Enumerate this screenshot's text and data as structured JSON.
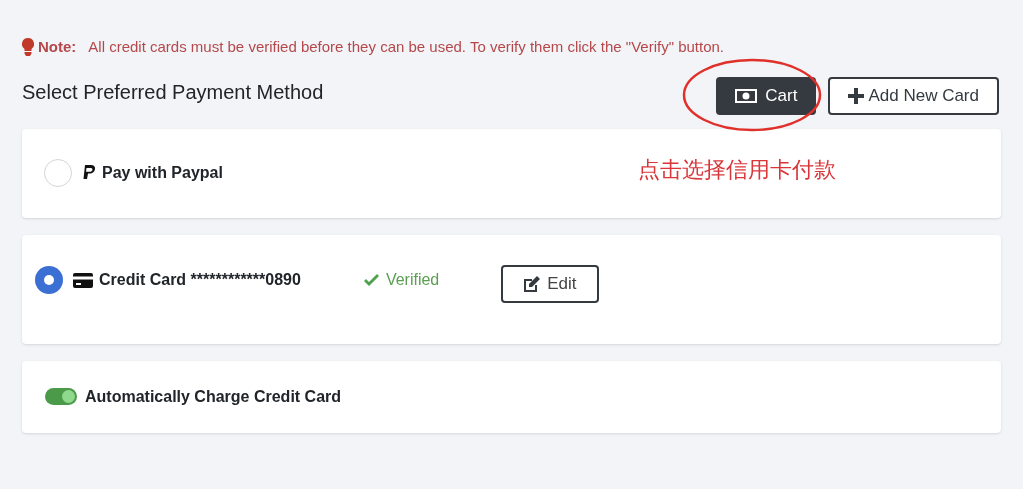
{
  "note": {
    "label": "Note:",
    "text": "All credit cards must be verified before they can be used. To verify them click the \"Verify\" button."
  },
  "heading": "Select Preferred Payment Method",
  "buttons": [
    {
      "kind": "cart",
      "label": "Cart",
      "highlighted": true
    },
    {
      "kind": "add",
      "label": "Add New Card",
      "highlighted": false
    }
  ],
  "methods": [
    {
      "kind": "paypal",
      "label": "Pay with Paypal",
      "selected": false,
      "annotation": "点击选择信用卡付款"
    },
    {
      "kind": "card",
      "label": "Credit Card ************0890",
      "selected": true,
      "status": "Verified",
      "action": "Edit"
    }
  ],
  "auto_charge": {
    "label": "Automatically Charge Credit Card",
    "on": true
  }
}
